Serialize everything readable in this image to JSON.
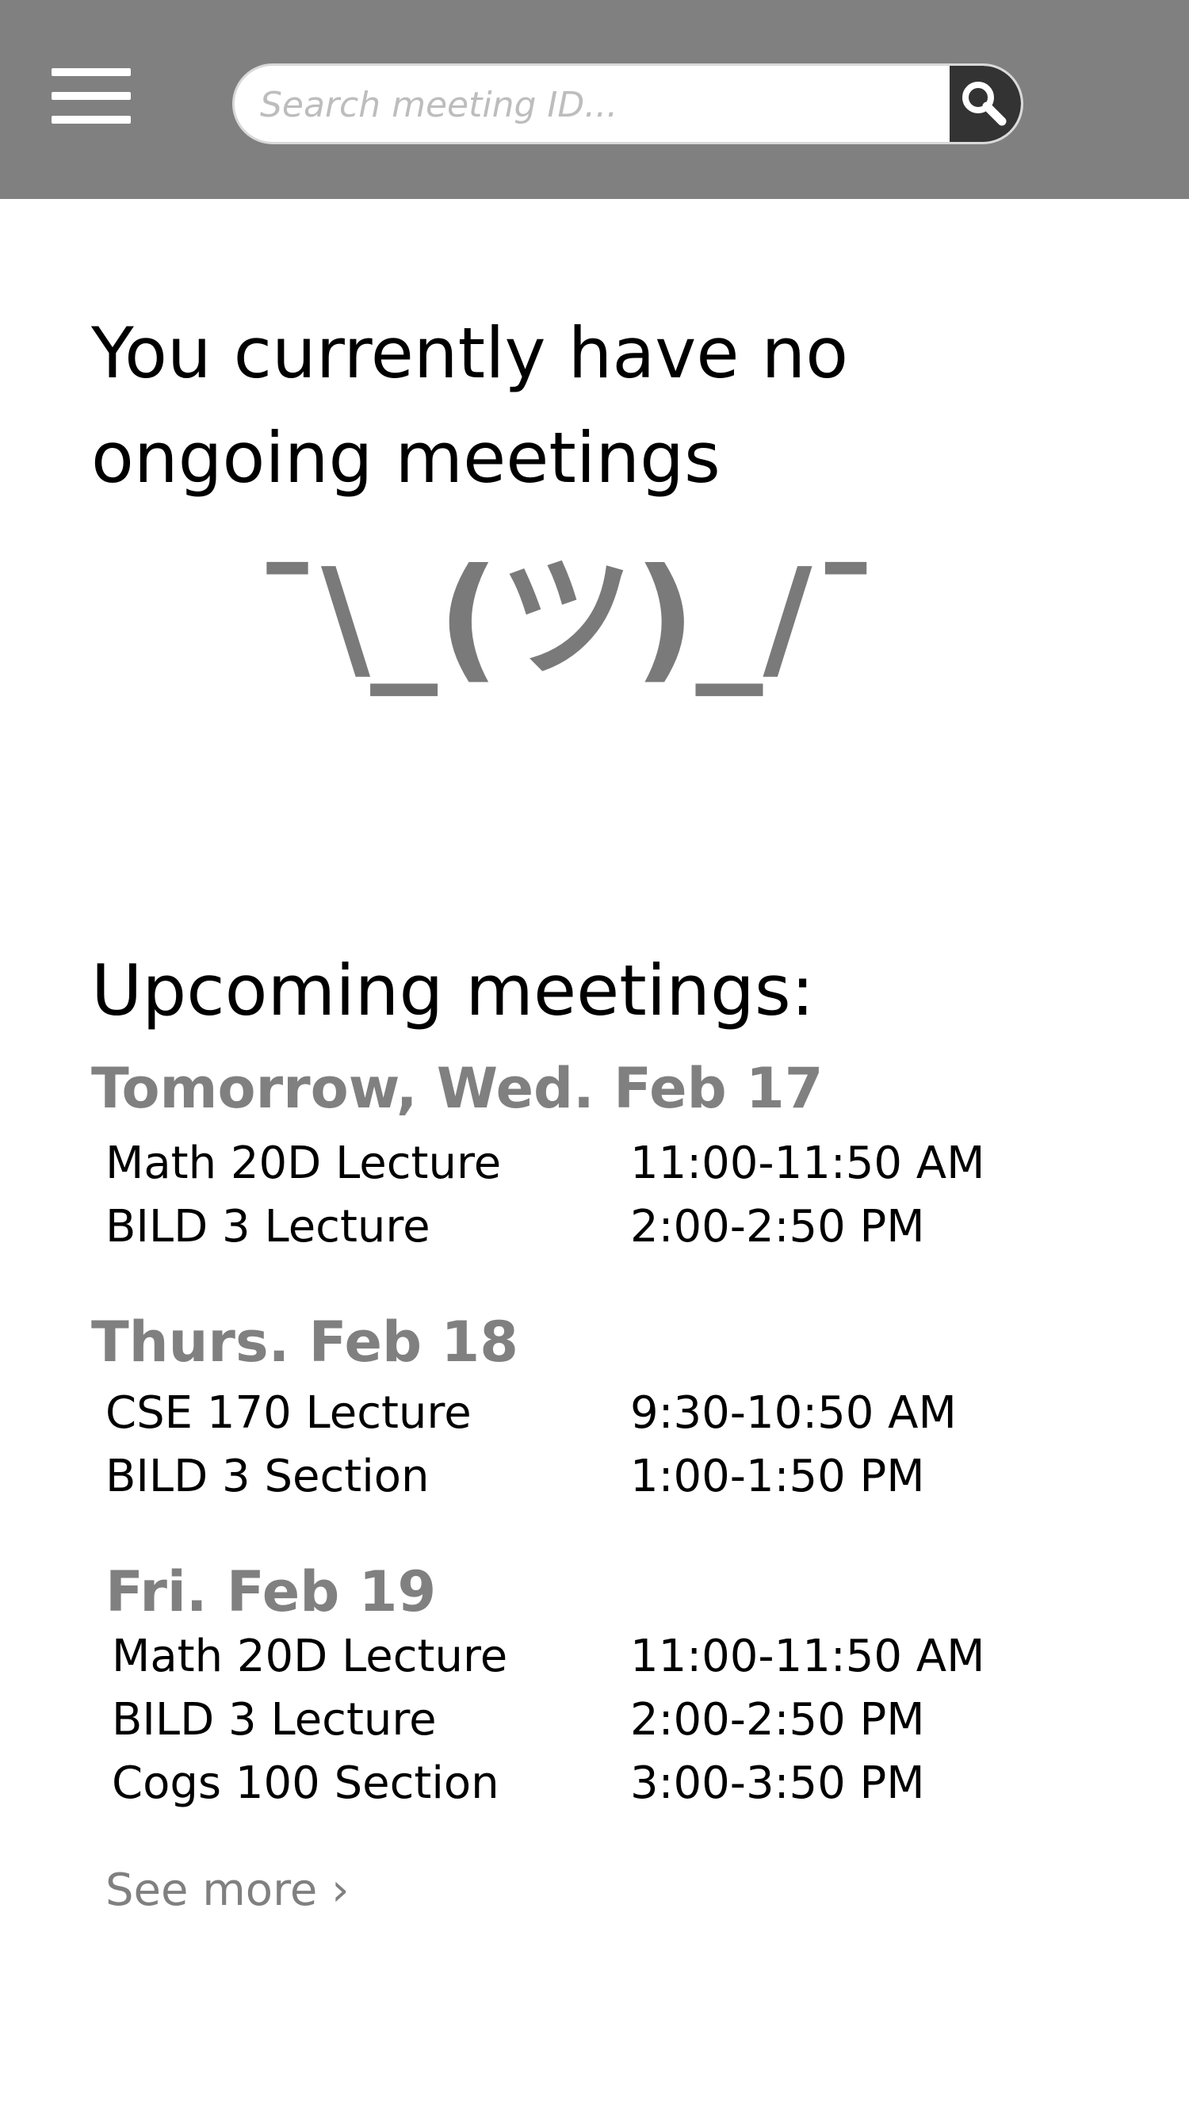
{
  "header": {
    "menu_icon": "hamburger-menu-icon",
    "search": {
      "placeholder": "Search meeting ID...",
      "value": "",
      "button_icon": "magnifier-icon"
    },
    "background_color": "#808080"
  },
  "ongoing": {
    "title": "You currently have no ongoing meetings",
    "emoticon": "¯\\_(ツ)_/¯"
  },
  "upcoming": {
    "title": "Upcoming meetings:",
    "days": [
      {
        "heading": "Tomorrow, Wed. Feb 17",
        "meetings": [
          {
            "name": "Math 20D Lecture",
            "time": "11:00-11:50 AM"
          },
          {
            "name": "BILD 3 Lecture",
            "time": "2:00-2:50 PM"
          }
        ]
      },
      {
        "heading": "Thurs. Feb 18",
        "meetings": [
          {
            "name": "CSE 170 Lecture",
            "time": "9:30-10:50 AM"
          },
          {
            "name": "BILD 3 Section",
            "time": "1:00-1:50 PM"
          }
        ]
      },
      {
        "heading": "Fri. Feb 19",
        "meetings": [
          {
            "name": "Math 20D Lecture",
            "time": "11:00-11:50 AM"
          },
          {
            "name": "BILD 3 Lecture",
            "time": "2:00-2:50 PM"
          },
          {
            "name": "Cogs 100 Section",
            "time": "3:00-3:50 PM"
          }
        ]
      }
    ],
    "see_more": "See more ›"
  }
}
